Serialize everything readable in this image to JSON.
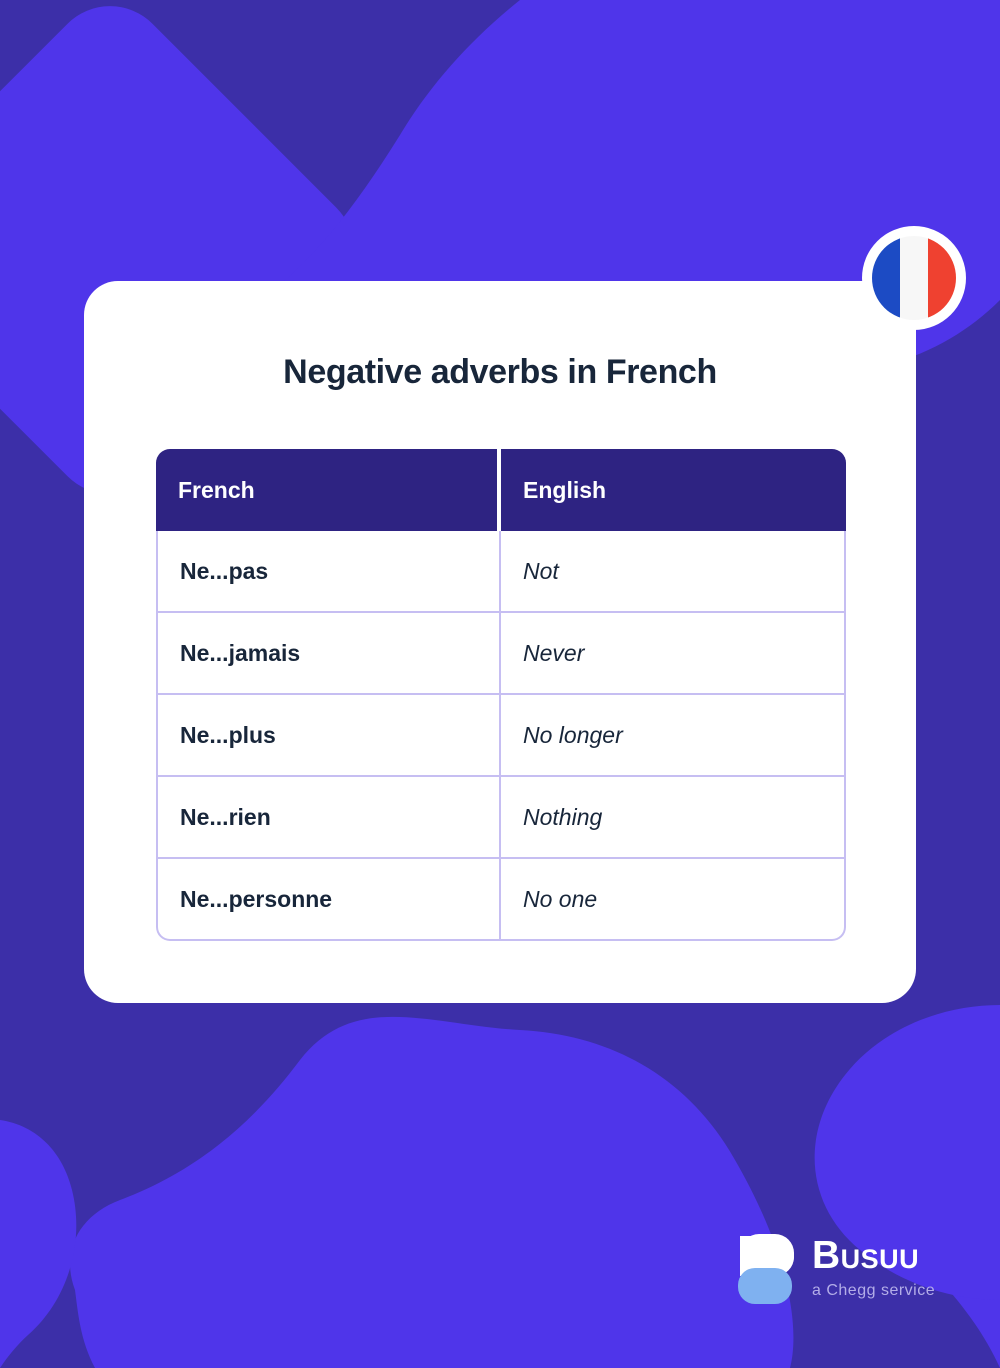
{
  "background": {
    "base_color": "#3C2FA8",
    "accent_color": "#4F35EA",
    "shape_names": [
      "rotated-rounded-square-top-left",
      "blob-top-right",
      "blob-bottom-left",
      "blob-bottom-right"
    ]
  },
  "flag_badge": {
    "country": "France",
    "icon": "french-flag-icon",
    "colors": [
      "#1C4BC4",
      "#F7F7F7",
      "#EF4130"
    ],
    "ring_color": "#FFFFFF"
  },
  "card": {
    "title": "Negative adverbs in French",
    "title_color": "#18263A",
    "background": "#FFFFFF"
  },
  "table": {
    "header_background": "#2E2382",
    "header_text_color": "#FFFFFF",
    "border_color": "#C6BEF2",
    "columns": [
      {
        "key": "french",
        "label": "French"
      },
      {
        "key": "english",
        "label": "English"
      }
    ],
    "rows": [
      {
        "french": "Ne...pas",
        "english": "Not"
      },
      {
        "french": "Ne...jamais",
        "english": "Never"
      },
      {
        "french": "Ne...plus",
        "english": "No longer"
      },
      {
        "french": "Ne...rien",
        "english": "Nothing"
      },
      {
        "french": "Ne...personne",
        "english": "No one"
      }
    ]
  },
  "logo": {
    "icon": "busuu-logo-icon",
    "wordmark": "Busuu",
    "tagline": "a Chegg service",
    "mark_top_color": "#FFFFFF",
    "mark_bottom_color": "#7FB1F0",
    "tagline_color": "#B3ADE8"
  }
}
